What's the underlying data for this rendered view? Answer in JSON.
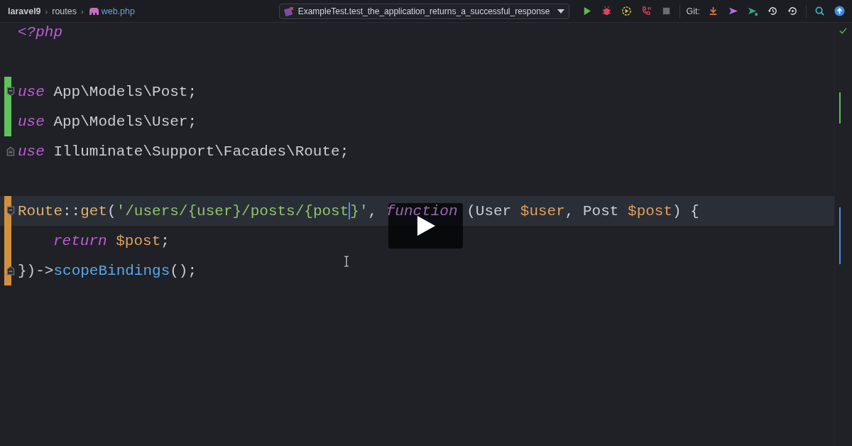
{
  "breadcrumbs": [
    {
      "label": "laravel9",
      "kind": "project"
    },
    {
      "label": "›",
      "kind": "sep"
    },
    {
      "label": "routes",
      "kind": "folder"
    },
    {
      "label": "›",
      "kind": "sep"
    },
    {
      "label": "web.php",
      "kind": "file"
    }
  ],
  "run_config": {
    "label": "ExampleTest.test_the_application_returns_a_successful_response"
  },
  "git_label": "Git:",
  "lines": [
    {
      "current": false,
      "tokens": [
        {
          "text": "<?php",
          "kind": "keyword"
        }
      ]
    },
    {
      "current": false
    },
    {
      "current": false,
      "added": true,
      "fold_start": true,
      "tokens": [
        {
          "text": "use",
          "kind": "keyword"
        },
        {
          "text": " App\\Models\\Post;",
          "kind": "plain"
        }
      ]
    },
    {
      "current": false,
      "added": true,
      "tokens": [
        {
          "text": "use",
          "kind": "keyword"
        },
        {
          "text": " App\\Models\\User;",
          "kind": "plain"
        }
      ]
    },
    {
      "current": false,
      "fold_end": true,
      "tokens": [
        {
          "text": "use",
          "kind": "keyword"
        },
        {
          "text": " Illuminate\\Support\\Facades\\Route;",
          "kind": "plain"
        }
      ]
    },
    {
      "current": false
    },
    {
      "current": true,
      "modified": true,
      "fold_start": true,
      "tokens": [
        {
          "text": "Route",
          "kind": "class"
        },
        {
          "text": "::",
          "kind": "plain"
        },
        {
          "text": "get",
          "kind": "class"
        },
        {
          "text": "(",
          "kind": "plain"
        },
        {
          "text": "'/users/{user}/posts/{post",
          "kind": "string",
          "caret": true
        },
        {
          "text": "}'",
          "kind": "string"
        },
        {
          "text": ", ",
          "kind": "plain"
        },
        {
          "text": "function",
          "kind": "faded"
        },
        {
          "text": " (User ",
          "kind": "plain"
        },
        {
          "text": "$user",
          "kind": "variable"
        },
        {
          "text": ", Post ",
          "kind": "plain"
        },
        {
          "text": "$post",
          "kind": "variable"
        },
        {
          "text": ") {",
          "kind": "plain"
        }
      ]
    },
    {
      "current": false,
      "modified": true,
      "indented": true,
      "tokens": [
        {
          "text": "return",
          "kind": "keyword"
        },
        {
          "text": " $post",
          "kind": "variable"
        },
        {
          "text": ";",
          "kind": "plain"
        }
      ]
    },
    {
      "current": false,
      "modified": true,
      "fold_end": true,
      "tokens": [
        {
          "text": "})->",
          "kind": "plain"
        },
        {
          "text": "scopeBindings",
          "kind": "method"
        },
        {
          "text": "();",
          "kind": "plain"
        }
      ]
    }
  ]
}
